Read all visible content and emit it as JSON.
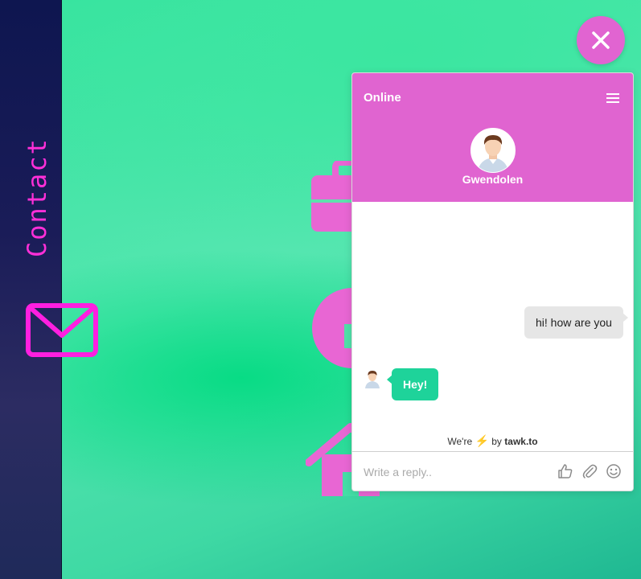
{
  "sidebar": {
    "label": "Contact",
    "icon": "mail-icon",
    "accent_color": "#ff2fd8"
  },
  "background_icons": [
    "briefcase-icon",
    "info-icon",
    "home-icon"
  ],
  "close_button": {
    "icon": "close-icon",
    "color": "#e164d1"
  },
  "chat": {
    "status": "Online",
    "agent_name": "Gwendolen",
    "header_color": "#e064d0",
    "messages": [
      {
        "from": "visitor",
        "text": "hi! how are you"
      },
      {
        "from": "agent",
        "text": "Hey!"
      }
    ],
    "branding": {
      "prefix": "We're",
      "by": "by",
      "brand": "tawk.to"
    },
    "reply": {
      "placeholder": "Write a reply.."
    },
    "footer_icons": [
      "thumbs-up-icon",
      "paperclip-icon",
      "smiley-icon"
    ]
  }
}
